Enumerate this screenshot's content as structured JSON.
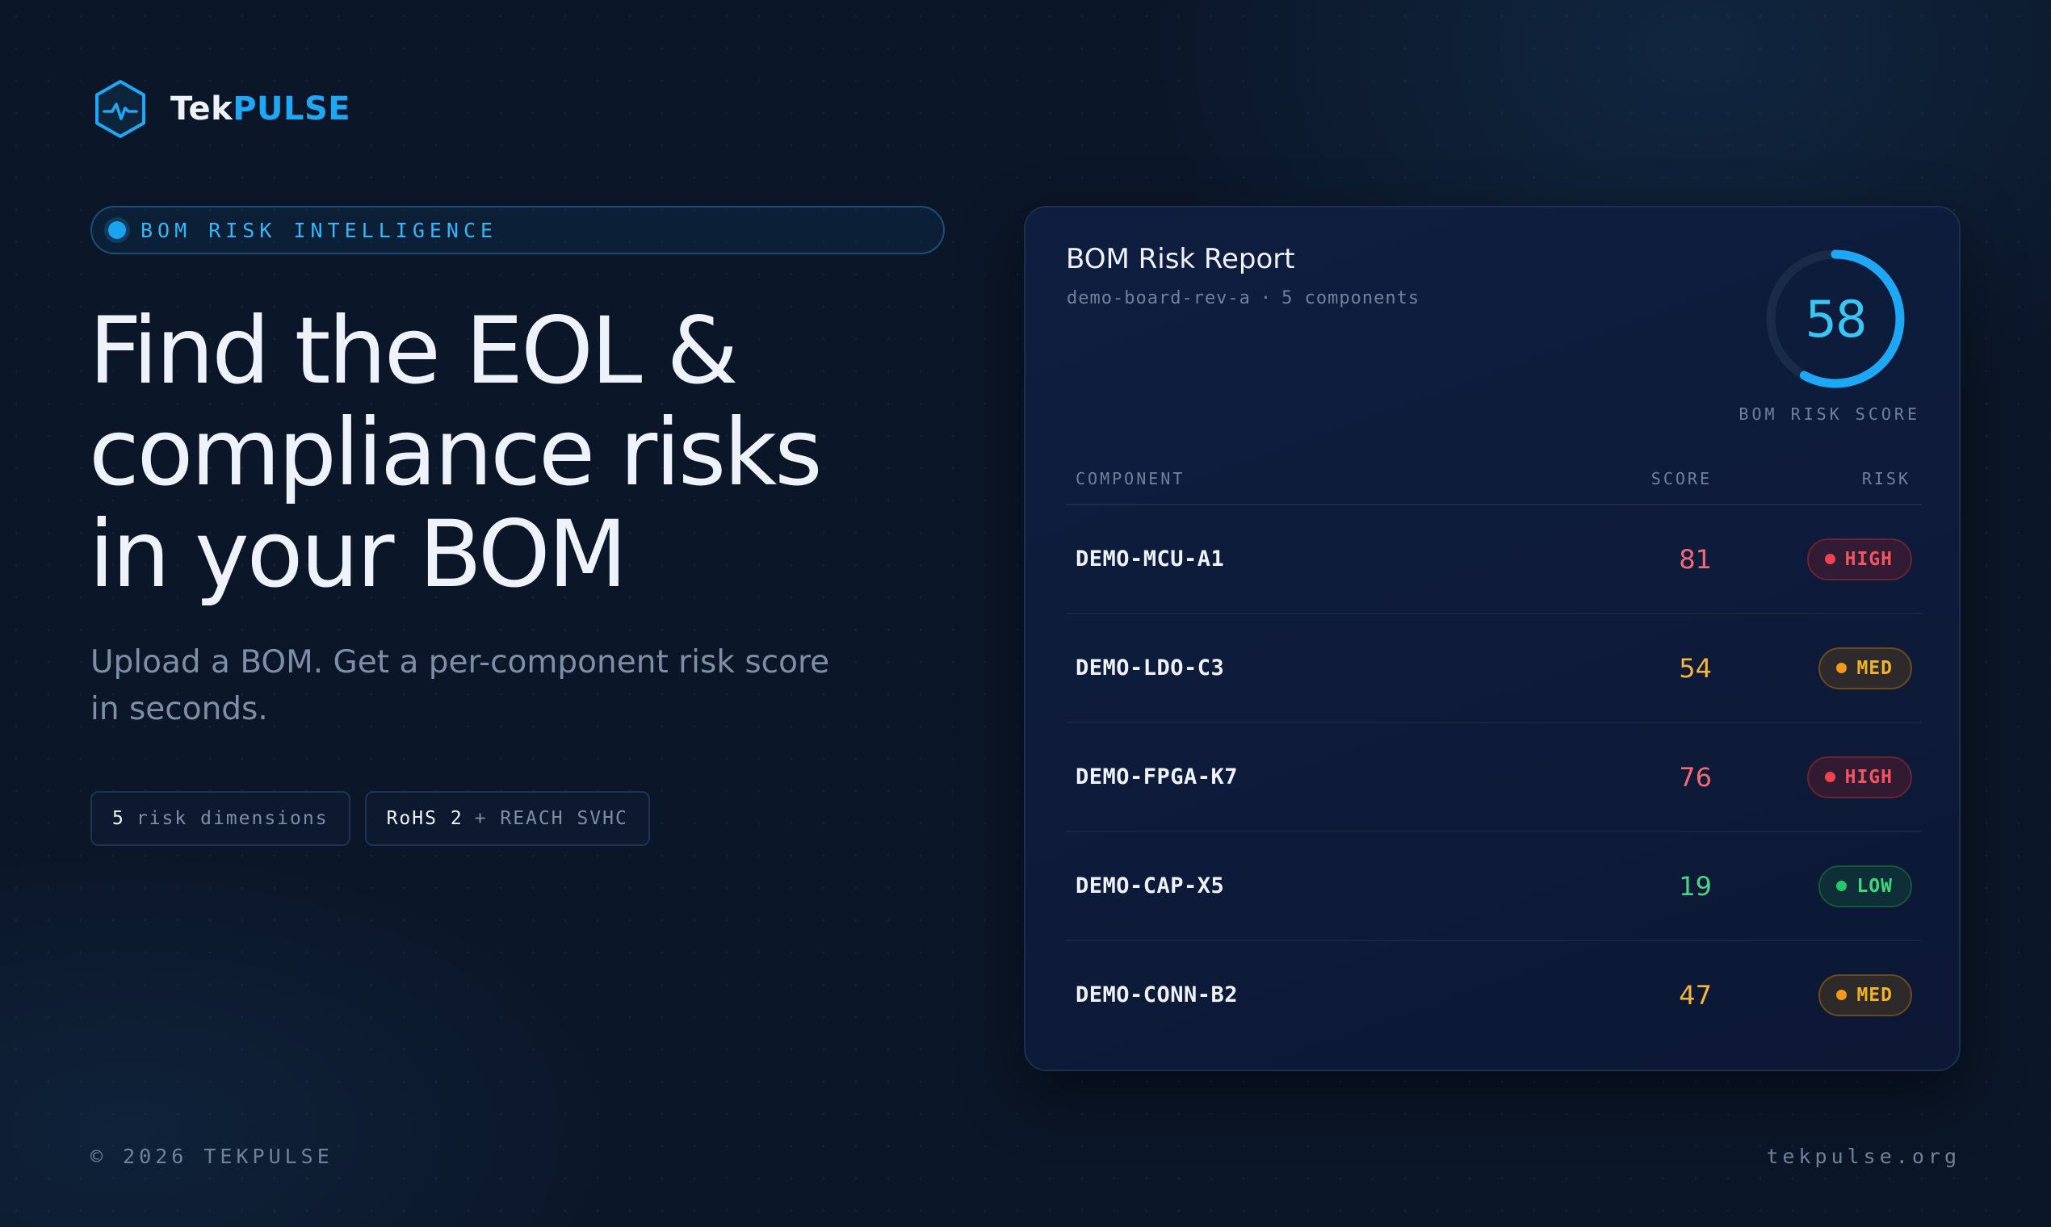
{
  "brand": {
    "name_part1": "Tek",
    "name_part2": "PULSE",
    "accent_color": "#1ea7f4",
    "logo_icon": "hexagon-pulse-icon"
  },
  "hero": {
    "eyebrow": "BOM RISK INTELLIGENCE",
    "headline_lines": [
      "Find the EOL &",
      "compliance risks",
      "in your BOM"
    ],
    "subtitle": "Upload a BOM. Get a per-component risk score in seconds.",
    "chips": [
      {
        "strong": "5",
        "rest": "risk dimensions"
      },
      {
        "strong": "RoHS 2",
        "rest": "+ REACH SVHC"
      }
    ]
  },
  "report": {
    "title": "BOM Risk Report",
    "board": "demo-board-rev-a",
    "separator": "·",
    "component_count": "5 components",
    "score": 58,
    "score_max": 100,
    "score_label": "BOM RISK SCORE",
    "columns": {
      "component": "COMPONENT",
      "score": "SCORE",
      "risk": "RISK"
    },
    "rows": [
      {
        "component": "DEMO-MCU-A1",
        "score": "81",
        "risk": "HIGH",
        "level": "high"
      },
      {
        "component": "DEMO-LDO-C3",
        "score": "54",
        "risk": "MED",
        "level": "med"
      },
      {
        "component": "DEMO-FPGA-K7",
        "score": "76",
        "risk": "HIGH",
        "level": "high"
      },
      {
        "component": "DEMO-CAP-X5",
        "score": "19",
        "risk": "LOW",
        "level": "low"
      },
      {
        "component": "DEMO-CONN-B2",
        "score": "47",
        "risk": "MED",
        "level": "med"
      }
    ],
    "level_colors": {
      "high": "#f26b74",
      "med": "#f5b53a",
      "low": "#4bd684"
    },
    "gauge_color": "#1ea7f4"
  },
  "footer": {
    "copyright": "© 2026 TEKPULSE",
    "site": "tekpulse.org"
  }
}
